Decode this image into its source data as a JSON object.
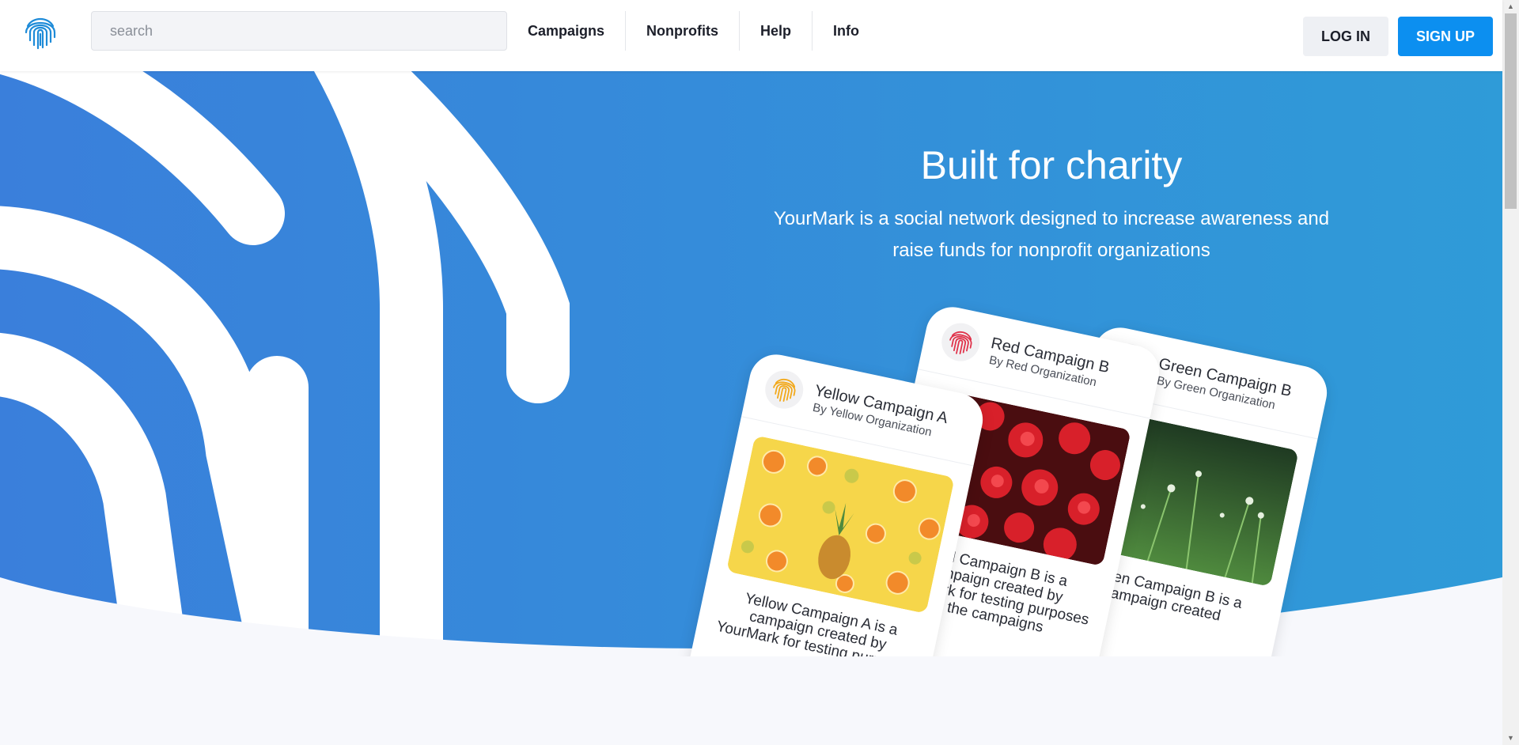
{
  "header": {
    "search_placeholder": "search",
    "nav": [
      "Campaigns",
      "Nonprofits",
      "Help",
      "Info"
    ],
    "login_label": "LOG IN",
    "signup_label": "SIGN UP"
  },
  "hero": {
    "title": "Built for charity",
    "subtitle": "YourMark is a social network designed to increase awareness and raise funds for nonprofit organizations"
  },
  "cards": [
    {
      "name": "Yellow Campaign A",
      "org": "By Yellow Organization",
      "description": "Yellow Campaign A is a campaign created by YourMark for testing purposes",
      "accent": "#f2a91c"
    },
    {
      "name": "Red Campaign B",
      "org": "By Red Organization",
      "description": "Red Campaign B is a campaign created by YourMark for testing purposes in the campaigns",
      "accent": "#e0334b"
    },
    {
      "name": "Green Campaign B",
      "org": "By Green Organization",
      "description": "Green Campaign B is a campaign created",
      "accent": "#5aa84a"
    }
  ],
  "colors": {
    "brand_blue": "#0c8ff0",
    "hero_blue": "#3a85dc",
    "logo_blue": "#1e8bd8"
  },
  "icons": {
    "logo": "fingerprint-icon",
    "scroll_up": "triangle-up-icon",
    "scroll_down": "triangle-down-icon"
  }
}
